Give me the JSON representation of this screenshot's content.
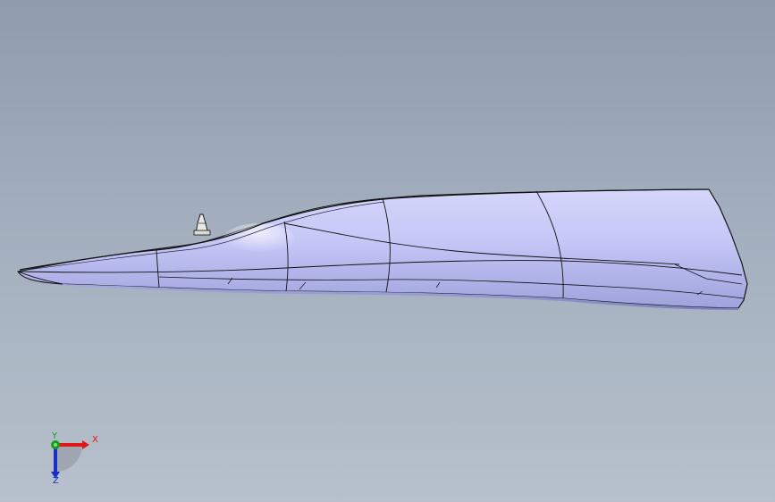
{
  "viewport": {
    "background_top": "#8e9cae",
    "background_bottom": "#b7c0cc"
  },
  "model": {
    "body_color": "#c2c4f4",
    "edge_color": "#111111"
  },
  "triad": {
    "x_label": "X",
    "y_label": "Y",
    "z_label": "Z",
    "x_color": "#e01818",
    "y_color": "#1a9a1a",
    "z_color": "#1a2fc8"
  }
}
